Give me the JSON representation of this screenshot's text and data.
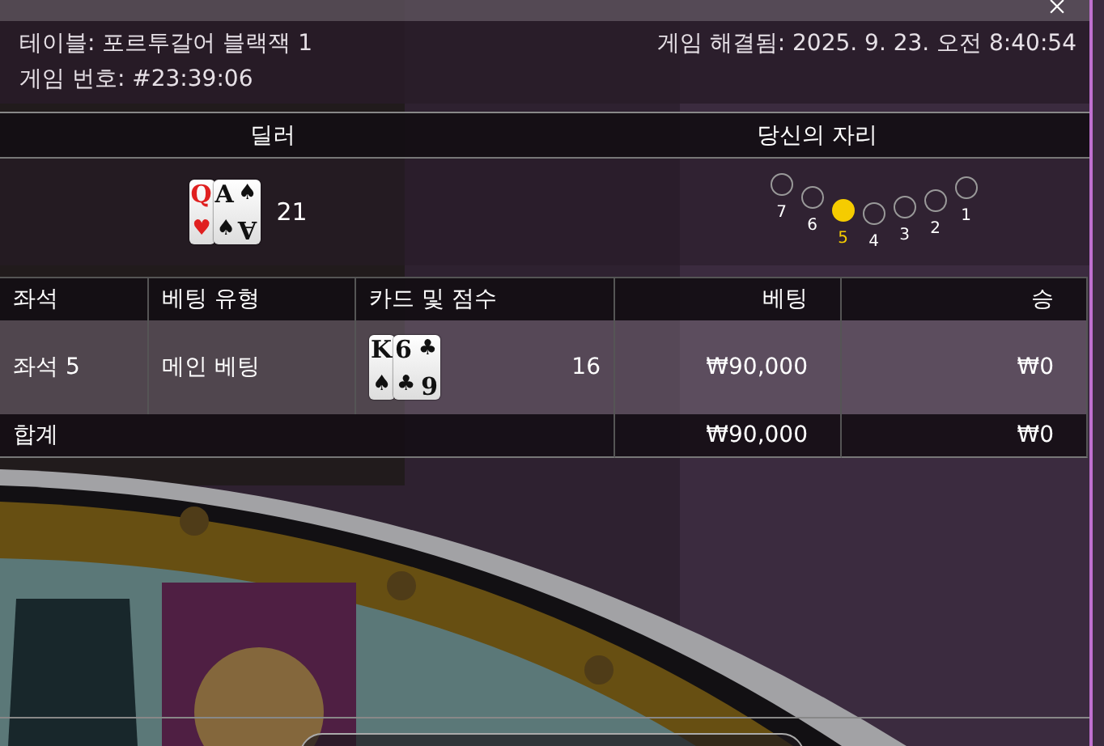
{
  "info": {
    "table": "테이블: 포르투갈어 블랙잭 1",
    "game_number": "게임 번호: #23:39:06",
    "resolved": "게임 해결됨: 2025. 9. 23. 오전 8:40:54"
  },
  "sections": [
    {
      "title": "딜러"
    },
    {
      "title": "당신의 자리"
    }
  ],
  "dealer": {
    "cards": [
      {
        "rank": "Q",
        "bottom_suit": "♥",
        "color": "#e02020"
      },
      {
        "rank": "A",
        "suit": "♠",
        "bottom_suit": "♠",
        "bottom_rank": "A",
        "color": "#111111"
      }
    ],
    "score": "21"
  },
  "seats": [
    {
      "label": "7",
      "selected": false
    },
    {
      "label": "6",
      "selected": false
    },
    {
      "label": "5",
      "selected": true
    },
    {
      "label": "4",
      "selected": false
    },
    {
      "label": "3",
      "selected": false
    },
    {
      "label": "2",
      "selected": false
    },
    {
      "label": "1",
      "selected": false
    }
  ],
  "table": {
    "columns": [
      "좌석",
      "베팅 유형",
      "카드 및 점수",
      "베팅",
      "승"
    ],
    "rows": [
      {
        "seat": "좌석 5",
        "bet_type": "메인 베팅",
        "cards": [
          {
            "rank": "K",
            "bottom_suit": "♠",
            "color": "#111111"
          },
          {
            "rank": "6",
            "suit": "♣",
            "bottom_suit": "♣",
            "bottom_rank": "6",
            "color": "#111111"
          }
        ],
        "score": "16",
        "bet": "₩90,000",
        "win": "₩0"
      }
    ],
    "total": {
      "label": "합계",
      "bet": "₩90,000",
      "win": "₩0"
    }
  }
}
